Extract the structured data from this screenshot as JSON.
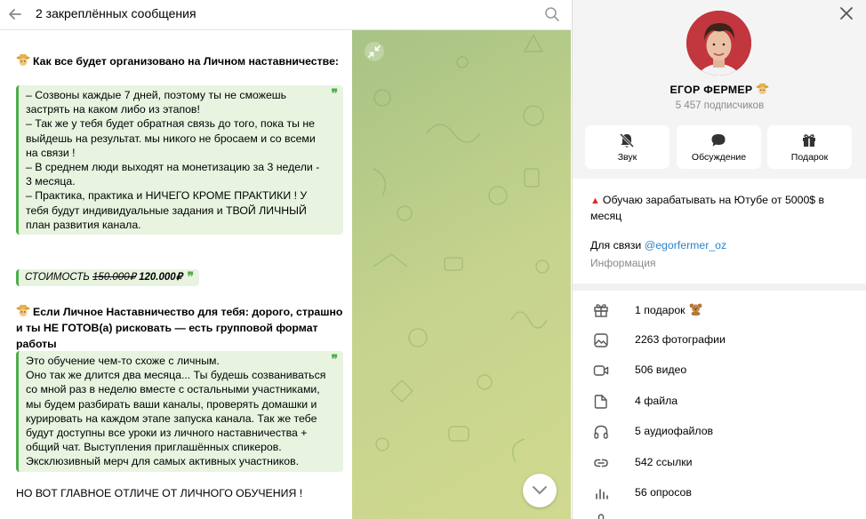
{
  "topbar": {
    "back_icon": "arrow-left-icon",
    "title": "2 закреплённых сообщения",
    "search_icon": "search-icon"
  },
  "messages": {
    "heading_1": "Как все будет организовано на Личном наставничестве:",
    "quote_1_lines": [
      "– Созвоны каждые 7 дней, поэтому ты не сможешь застрять на каком либо из этапов!",
      "– Так же у тебя будет обратная связь до того, пока ты не выйдешь на результат. мы никого не бросаем и со всеми на связи !",
      "– В среднем люди выходят на монетизацию за 3 недели - 3 месяца.",
      "– Практика, практика и НИЧЕГО КРОМЕ ПРАКТИКИ ! У тебя будут индивидуальные задания и ТВОЙ ЛИЧНЫЙ план развития канала."
    ],
    "price_label": "СТОИМОСТЬ",
    "price_old": "150.000₽",
    "price_new": "120.000₽",
    "heading_2": "Если Личное Наставничество для тебя: дорого, страшно и ты НЕ ГОТОВ(а) рисковать — есть групповой формат работы",
    "quote_2_lines": [
      "Это обучение чем-то схоже с личным.",
      "Оно так же длится два месяца... Ты будешь созваниваться со мной раз в неделю вместе с остальными участниками, мы будем разбирать ваши каналы, проверять домашки и курировать на каждом этапе запуска канала. Так же тебе будут доступны все уроки из личного наставничества + общий чат. Выступления приглашённых спикеров.",
      "Эксклюзивный мерч для самых активных участников."
    ],
    "final_line": "НО ВОТ ГЛАВНОЕ ОТЛИЧЕ ОТ ЛИЧНОГО ОБУЧЕНИЯ !"
  },
  "colors": {
    "accent_green": "#4fae4e",
    "quote_bg": "#e8f4e0",
    "link_blue": "#2b82c8",
    "avatar_bg": "#c2363e"
  },
  "profile": {
    "close_icon": "close-icon",
    "channel_name": "ЕГОР ФЕРМЕР",
    "subscribers": "5 457 подписчиков",
    "actions": [
      {
        "icon": "bell-off-icon",
        "label": "Звук"
      },
      {
        "icon": "chat-bubble-icon",
        "label": "Обсуждение"
      },
      {
        "icon": "gift-icon",
        "label": "Подарок"
      }
    ],
    "about": "Обучаю зарабатывать на Ютубе от 5000$ в месяц",
    "contact_prefix": "Для связи",
    "contact_link": "@egorfermer_oz",
    "info_label": "Информация",
    "media": [
      {
        "icon": "gift-icon",
        "label": "1 подарок"
      },
      {
        "icon": "photo-icon",
        "label": "2263 фотографии"
      },
      {
        "icon": "video-icon",
        "label": "506 видео"
      },
      {
        "icon": "file-icon",
        "label": "4 файла"
      },
      {
        "icon": "headphones-icon",
        "label": "5 аудиофайлов"
      },
      {
        "icon": "link-icon",
        "label": "542 ссылки"
      },
      {
        "icon": "poll-icon",
        "label": "56 опросов"
      }
    ]
  }
}
